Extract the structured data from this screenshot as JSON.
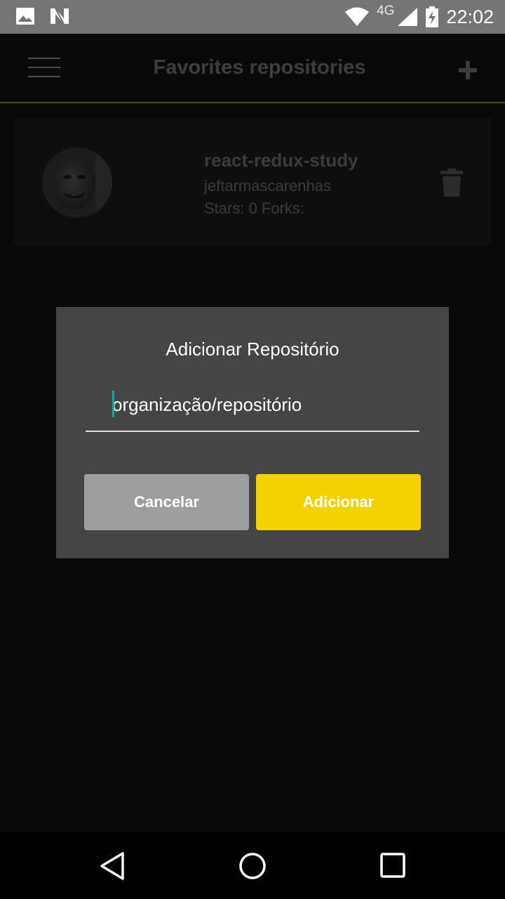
{
  "status_bar": {
    "time": "22:02",
    "network": "4G",
    "icons": [
      "image-icon",
      "notification-n-icon",
      "wifi-icon",
      "signal-icon",
      "battery-charging-icon"
    ]
  },
  "header": {
    "title": "Favorites repositories",
    "menu_icon": "hamburger-menu-icon",
    "add_icon": "plus-icon"
  },
  "repositories": [
    {
      "name": "react-redux-study",
      "owner": "jeftarmascarenhas",
      "stats": "Stars: 0 Forks:",
      "avatar": "avatar-photo",
      "delete_icon": "trash-icon"
    }
  ],
  "modal": {
    "title": "Adicionar Repositório",
    "input_placeholder": "organização/repositório",
    "input_value": "",
    "cancel_label": "Cancelar",
    "add_label": "Adicionar"
  },
  "colors": {
    "accent": "#f2d300",
    "cancel": "#9e9e9e",
    "modal_bg": "#454545",
    "cursor": "#1aa598",
    "header_divider": "#5a4c12"
  },
  "nav_bar": {
    "icons": [
      "back-icon",
      "home-icon",
      "recents-icon"
    ]
  }
}
